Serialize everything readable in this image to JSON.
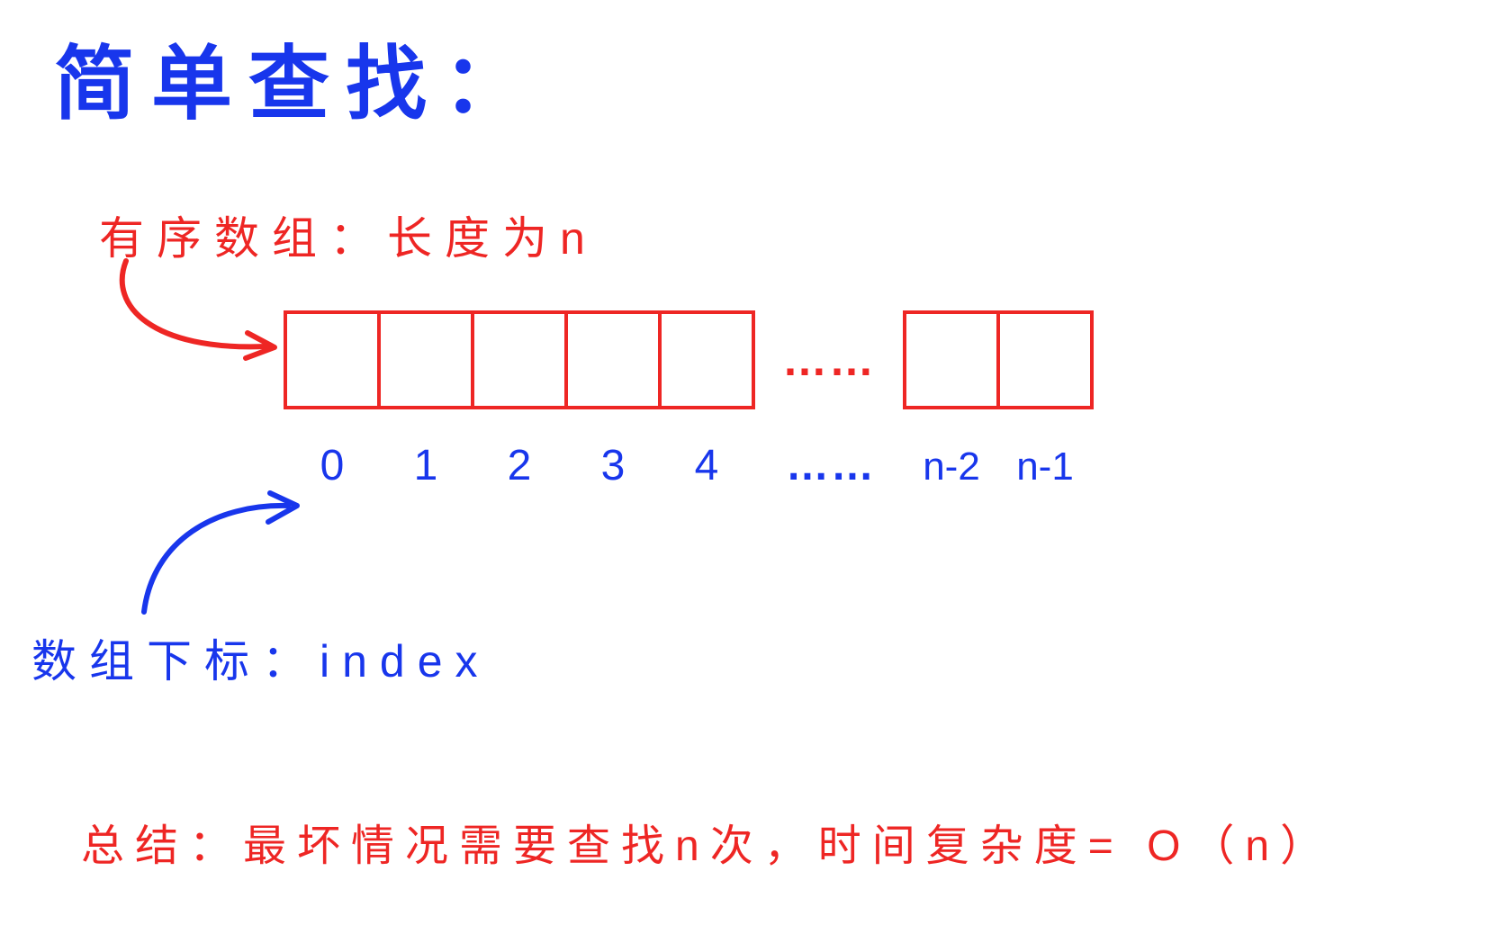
{
  "title": "简单查找：",
  "array_label": "有序数组：长度为n",
  "ellipsis_red": "……",
  "ellipsis_blue": "……",
  "indices": [
    "0",
    "1",
    "2",
    "3",
    "4"
  ],
  "tail_indices": [
    "n-2",
    "n-1"
  ],
  "index_label": "数组下标：index",
  "summary": "总结：最坏情况需要查找n次，时间复杂度= O（n）",
  "colors": {
    "blue": "#1836ec",
    "red": "#ee2624"
  }
}
